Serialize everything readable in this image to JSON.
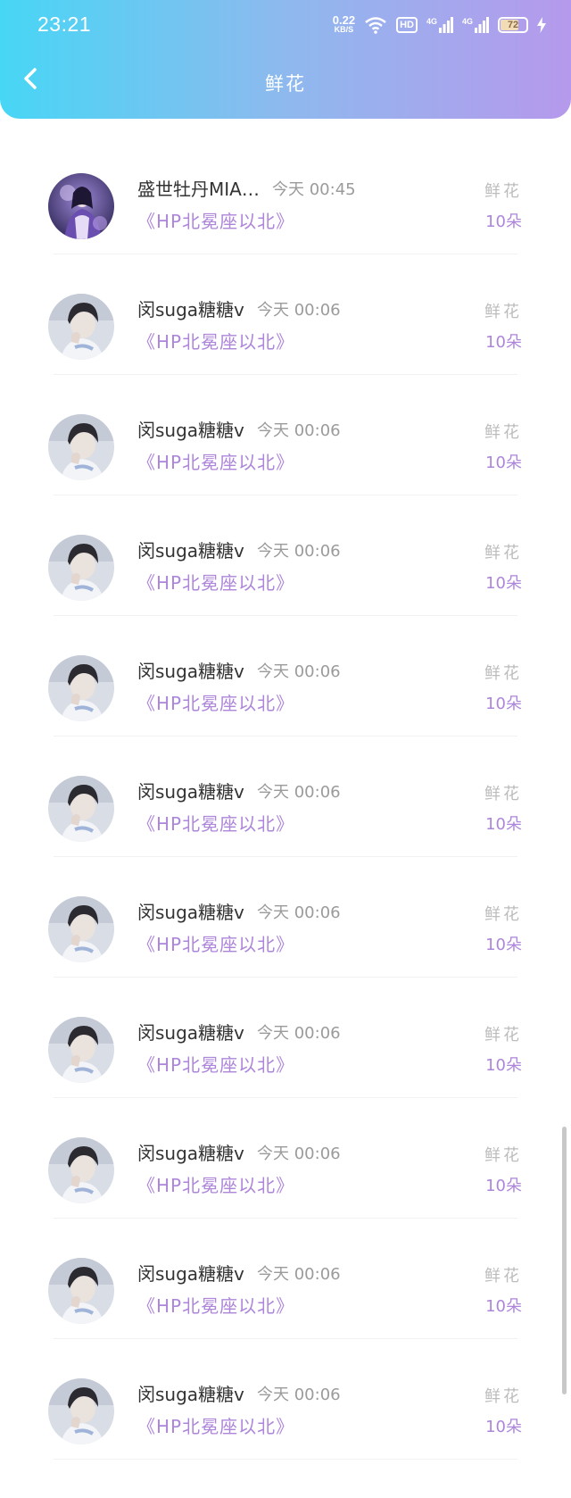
{
  "status_bar": {
    "time": "23:21",
    "net_speed": "0.22",
    "net_unit": "KB/S",
    "hd": "HD",
    "signal_1": "4G",
    "signal_2": "4G",
    "battery": "72",
    "battery_level": 0.72,
    "icons": [
      "wifi-icon",
      "signal-icon",
      "battery-icon",
      "charging-icon"
    ]
  },
  "header": {
    "title": "鲜花",
    "back_icon": "chevron-left-icon",
    "gradient": [
      "#47d6f5",
      "#b699ec"
    ]
  },
  "colors": {
    "accent": "#ad86da",
    "muted": "#9b9b9b",
    "label": "#bcbcbc",
    "text": "#333333"
  },
  "items": [
    {
      "avatar": "avatar-image-1",
      "name": "盛世牡丹MIA…",
      "time": "今天 00:45",
      "book": "《HP北冕座以北》",
      "gift": "鲜花",
      "count": "10朵"
    },
    {
      "avatar": "avatar-image-2",
      "name": "闵suga糖糖v",
      "time": "今天 00:06",
      "book": "《HP北冕座以北》",
      "gift": "鲜花",
      "count": "10朵"
    },
    {
      "avatar": "avatar-image-2",
      "name": "闵suga糖糖v",
      "time": "今天 00:06",
      "book": "《HP北冕座以北》",
      "gift": "鲜花",
      "count": "10朵"
    },
    {
      "avatar": "avatar-image-2",
      "name": "闵suga糖糖v",
      "time": "今天 00:06",
      "book": "《HP北冕座以北》",
      "gift": "鲜花",
      "count": "10朵"
    },
    {
      "avatar": "avatar-image-2",
      "name": "闵suga糖糖v",
      "time": "今天 00:06",
      "book": "《HP北冕座以北》",
      "gift": "鲜花",
      "count": "10朵"
    },
    {
      "avatar": "avatar-image-2",
      "name": "闵suga糖糖v",
      "time": "今天 00:06",
      "book": "《HP北冕座以北》",
      "gift": "鲜花",
      "count": "10朵"
    },
    {
      "avatar": "avatar-image-2",
      "name": "闵suga糖糖v",
      "time": "今天 00:06",
      "book": "《HP北冕座以北》",
      "gift": "鲜花",
      "count": "10朵"
    },
    {
      "avatar": "avatar-image-2",
      "name": "闵suga糖糖v",
      "time": "今天 00:06",
      "book": "《HP北冕座以北》",
      "gift": "鲜花",
      "count": "10朵"
    },
    {
      "avatar": "avatar-image-2",
      "name": "闵suga糖糖v",
      "time": "今天 00:06",
      "book": "《HP北冕座以北》",
      "gift": "鲜花",
      "count": "10朵"
    },
    {
      "avatar": "avatar-image-2",
      "name": "闵suga糖糖v",
      "time": "今天 00:06",
      "book": "《HP北冕座以北》",
      "gift": "鲜花",
      "count": "10朵"
    },
    {
      "avatar": "avatar-image-2",
      "name": "闵suga糖糖v",
      "time": "今天 00:06",
      "book": "《HP北冕座以北》",
      "gift": "鲜花",
      "count": "10朵"
    }
  ]
}
